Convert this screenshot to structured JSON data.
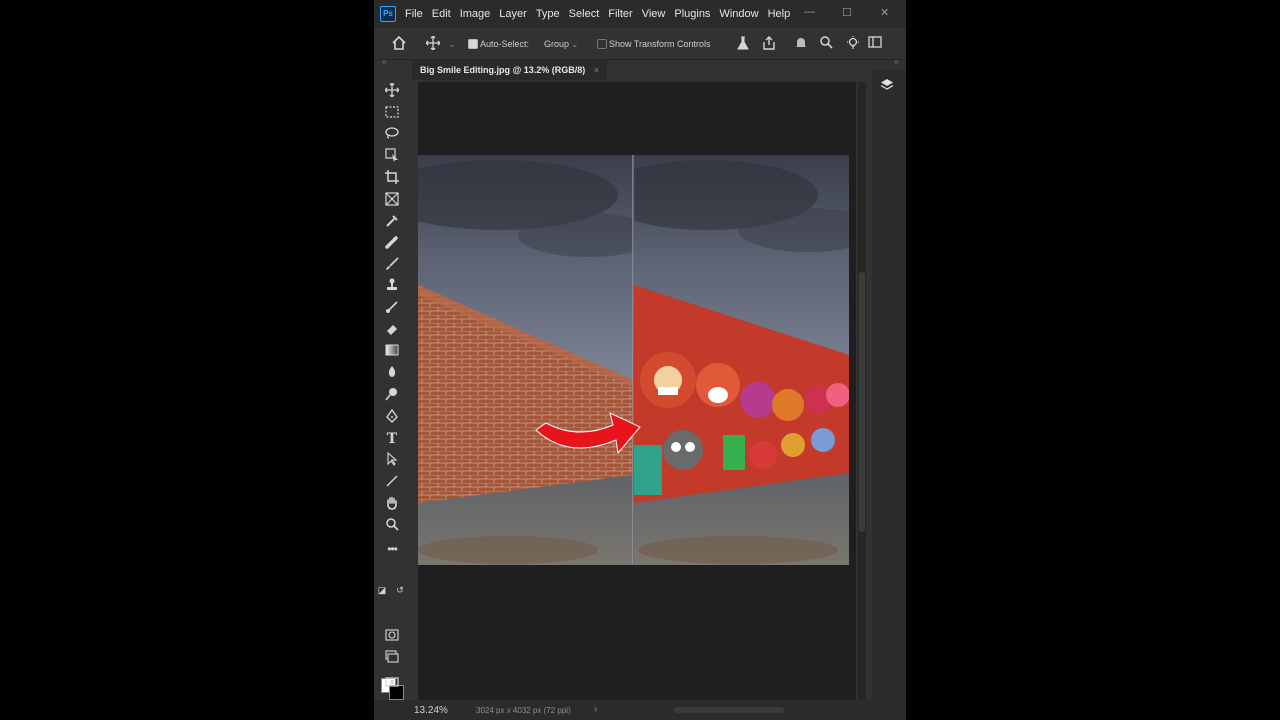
{
  "app": {
    "logo": "Ps"
  },
  "menu": [
    "File",
    "Edit",
    "Image",
    "Layer",
    "Type",
    "Select",
    "Filter",
    "View",
    "Plugins",
    "Window",
    "Help"
  ],
  "window_controls": {
    "minimize": "—",
    "maximize": "☐",
    "close": "✕"
  },
  "options": {
    "auto_select_label": "Auto-Select:",
    "auto_select_checked": true,
    "auto_select_mode": "Group",
    "transform_controls_label": "Show Transform Controls",
    "transform_controls_checked": false
  },
  "document_tab": {
    "title": "Big Smile Editing.jpg @ 13.2% (RGB/8)",
    "close": "×"
  },
  "toolbar": {
    "tools": [
      "move-tool",
      "marquee-tool",
      "lasso-tool",
      "object-select-tool",
      "crop-tool",
      "frame-tool",
      "eyedropper-tool",
      "spot-healing-tool",
      "brush-tool",
      "clone-stamp-tool",
      "history-brush-tool",
      "eraser-tool",
      "gradient-tool",
      "blur-tool",
      "dodge-tool",
      "pen-tool",
      "type-tool",
      "path-select-tool",
      "line-tool",
      "hand-tool",
      "zoom-tool",
      "more-tools"
    ],
    "type_tool_glyph": "T"
  },
  "colors": {
    "foreground": "#ffffff",
    "background": "#000000",
    "accent_red": "#e8141b"
  },
  "status": {
    "zoom": "13.24%",
    "doc_info": "3024 px x 4032 px (72 ppi)",
    "arrow": "›"
  }
}
